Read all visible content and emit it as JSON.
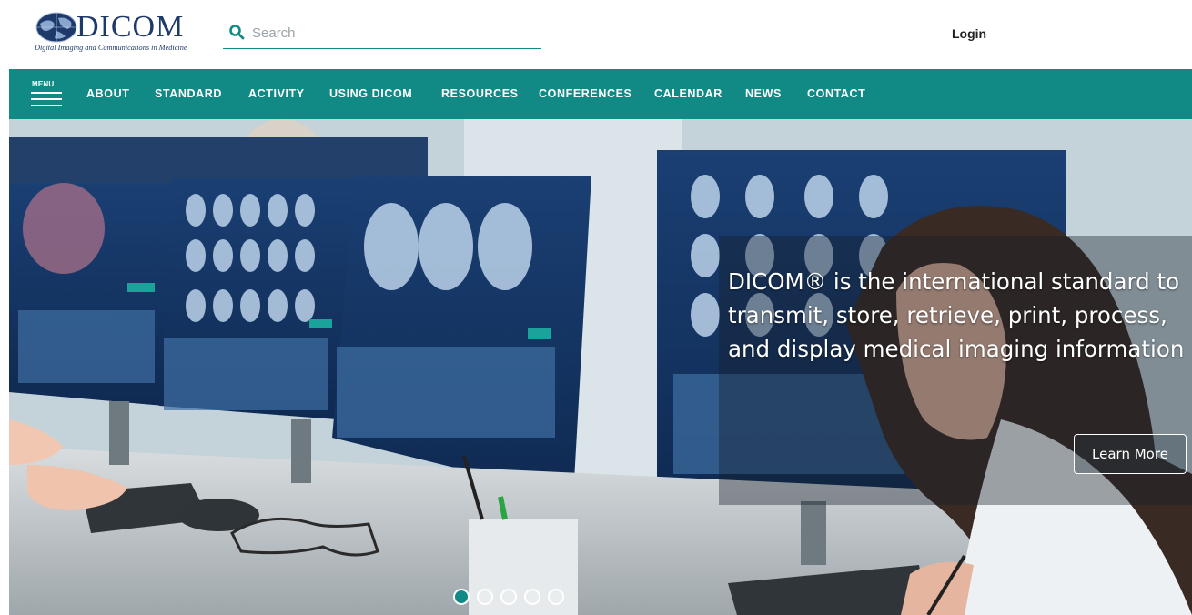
{
  "header": {
    "logo_text": "DICOM",
    "logo_tagline": "Digital Imaging and Communications in Medicine",
    "search_placeholder": "Search",
    "login_label": "Login"
  },
  "nav": {
    "menu_label": "MENU",
    "items": [
      {
        "label": "ABOUT"
      },
      {
        "label": "STANDARD"
      },
      {
        "label": "ACTIVITY"
      },
      {
        "label": "USING DICOM"
      },
      {
        "label": "RESOURCES"
      },
      {
        "label": "CONFERENCES"
      },
      {
        "label": "CALENDAR"
      },
      {
        "label": "NEWS"
      },
      {
        "label": "CONTACT"
      }
    ]
  },
  "hero": {
    "caption": "DICOM® is the international standard to transmit, store, retrieve, print, process, and display medical imaging information",
    "cta_label": "Learn More",
    "slide_count": 5,
    "active_slide": 1
  },
  "colors": {
    "brand_teal": "#118a85",
    "logo_navy": "#1d3a6b"
  }
}
